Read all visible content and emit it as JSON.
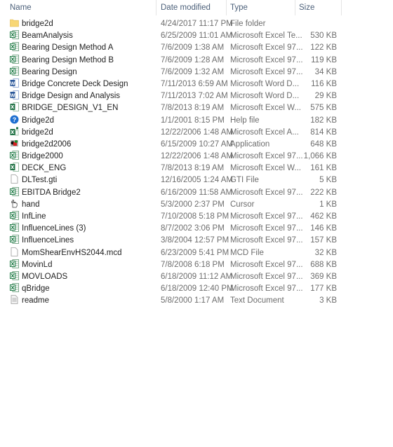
{
  "columns": {
    "name": "Name",
    "date": "Date modified",
    "type": "Type",
    "size": "Size"
  },
  "files": [
    {
      "name": "bridge2d",
      "date": "4/24/2017 11:17 PM",
      "type": "File folder",
      "size": "",
      "icon": "folder"
    },
    {
      "name": "BeamAnalysis",
      "date": "6/25/2009 11:01 AM",
      "type": "Microsoft Excel Te...",
      "size": "530 KB",
      "icon": "excel-legacy"
    },
    {
      "name": "Bearing Design Method A",
      "date": "7/6/2009 1:38 AM",
      "type": "Microsoft Excel 97...",
      "size": "122 KB",
      "icon": "excel-legacy"
    },
    {
      "name": "Bearing Design Method B",
      "date": "7/6/2009 1:28 AM",
      "type": "Microsoft Excel 97...",
      "size": "119 KB",
      "icon": "excel-legacy"
    },
    {
      "name": "Bearing Design",
      "date": "7/6/2009 1:32 AM",
      "type": "Microsoft Excel 97...",
      "size": "34 KB",
      "icon": "excel-legacy"
    },
    {
      "name": "Bridge Concrete Deck Design",
      "date": "7/11/2013 6:59 AM",
      "type": "Microsoft Word D...",
      "size": "116 KB",
      "icon": "word"
    },
    {
      "name": "Bridge Design and Analysis",
      "date": "7/11/2013 7:02 AM",
      "type": "Microsoft Word D...",
      "size": "29 KB",
      "icon": "word"
    },
    {
      "name": "BRIDGE_DESIGN_V1_EN",
      "date": "7/8/2013 8:19 AM",
      "type": "Microsoft Excel W...",
      "size": "575 KB",
      "icon": "excel"
    },
    {
      "name": "Bridge2d",
      "date": "1/1/2001 8:15 PM",
      "type": "Help file",
      "size": "182 KB",
      "icon": "help"
    },
    {
      "name": "bridge2d",
      "date": "12/22/2006 1:48 AM",
      "type": "Microsoft Excel A...",
      "size": "814 KB",
      "icon": "excel-addin"
    },
    {
      "name": "bridge2d2006",
      "date": "6/15/2009 10:27 AM",
      "type": "Application",
      "size": "648 KB",
      "icon": "application"
    },
    {
      "name": "Bridge2000",
      "date": "12/22/2006 1:48 AM",
      "type": "Microsoft Excel 97...",
      "size": "1,066 KB",
      "icon": "excel-legacy"
    },
    {
      "name": "DECK_ENG",
      "date": "7/8/2013 8:19 AM",
      "type": "Microsoft Excel W...",
      "size": "161 KB",
      "icon": "excel"
    },
    {
      "name": "DLTest.gti",
      "date": "12/16/2005 1:24 AM",
      "type": "GTI File",
      "size": "5 KB",
      "icon": "blank-file"
    },
    {
      "name": "EBITDA Bridge2",
      "date": "6/16/2009 11:58 AM",
      "type": "Microsoft Excel 97...",
      "size": "222 KB",
      "icon": "excel-legacy"
    },
    {
      "name": "hand",
      "date": "5/3/2000 2:37 PM",
      "type": "Cursor",
      "size": "1 KB",
      "icon": "cursor"
    },
    {
      "name": "InfLine",
      "date": "7/10/2008 5:18 PM",
      "type": "Microsoft Excel 97...",
      "size": "462 KB",
      "icon": "excel-legacy"
    },
    {
      "name": "InfluenceLines (3)",
      "date": "8/7/2002 3:06 PM",
      "type": "Microsoft Excel 97...",
      "size": "146 KB",
      "icon": "excel-legacy"
    },
    {
      "name": "InfluenceLines",
      "date": "3/8/2004 12:57 PM",
      "type": "Microsoft Excel 97...",
      "size": "157 KB",
      "icon": "excel-legacy"
    },
    {
      "name": "MomShearEnvHS2044.mcd",
      "date": "6/23/2009 5:41 PM",
      "type": "MCD File",
      "size": "32 KB",
      "icon": "blank-file"
    },
    {
      "name": "MovinLd",
      "date": "7/8/2008 6:18 PM",
      "type": "Microsoft Excel 97...",
      "size": "688 KB",
      "icon": "excel-legacy"
    },
    {
      "name": "MOVLOADS",
      "date": "6/18/2009 11:12 AM",
      "type": "Microsoft Excel 97...",
      "size": "369 KB",
      "icon": "excel-legacy"
    },
    {
      "name": "qBridge",
      "date": "6/18/2009 12:40 PM",
      "type": "Microsoft Excel 97...",
      "size": "177 KB",
      "icon": "excel-legacy"
    },
    {
      "name": "readme",
      "date": "5/8/2000 1:17 AM",
      "type": "Text Document",
      "size": "3 KB",
      "icon": "text-file"
    }
  ]
}
